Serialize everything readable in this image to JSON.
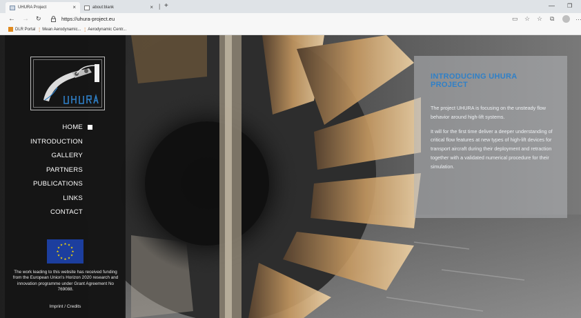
{
  "browser": {
    "tabs": [
      {
        "title": "UHURA Project",
        "active": true
      },
      {
        "title": "about:blank",
        "active": false
      }
    ],
    "tab_close_glyph": "×",
    "tab_separator": "|",
    "new_tab_glyph": "+",
    "minimize_glyph": "—",
    "restore_glyph": "❐",
    "url": "https://uhura-project.eu",
    "favorites": [
      {
        "label": "DLR Portal"
      },
      {
        "label": "Mean Aerodynamic..."
      },
      {
        "label": "Aerodynamic Centr..."
      }
    ],
    "icons": {
      "back": "←",
      "forward": "→",
      "reload": "↻",
      "reader": "▭",
      "favorite": "☆",
      "favorites": "☆",
      "collections": "⧉",
      "more": "…"
    }
  },
  "sidebar": {
    "menu": [
      {
        "label": "HOME",
        "active": true
      },
      {
        "label": "INTRODUCTION"
      },
      {
        "label": "GALLERY"
      },
      {
        "label": "PARTNERS"
      },
      {
        "label": "PUBLICATIONS"
      },
      {
        "label": "LINKS"
      },
      {
        "label": "CONTACT"
      }
    ],
    "funding_text": "The work leading to this website has received funding from the European Union's Horizon 2020 research and innovation programme under Grant Agreement No 769088.",
    "imprint_label": "Imprint / Credits"
  },
  "intro": {
    "title": "INTRODUCING UHURA PROJECT",
    "paragraphs": [
      "The project UHURA is focusing on the unsteady flow behavior around high-lift systems.",
      "It will for the first time deliver a deeper understanding of critical flow features at new types of high-lift devices for transport aircraft during their deployment and retraction together with a validated numerical procedure for their simulation."
    ]
  },
  "colors": {
    "accent": "#2f80c8",
    "sidebar_bg": "#141414",
    "eu_blue": "#1c3e9e",
    "eu_gold": "#ffdd00"
  }
}
